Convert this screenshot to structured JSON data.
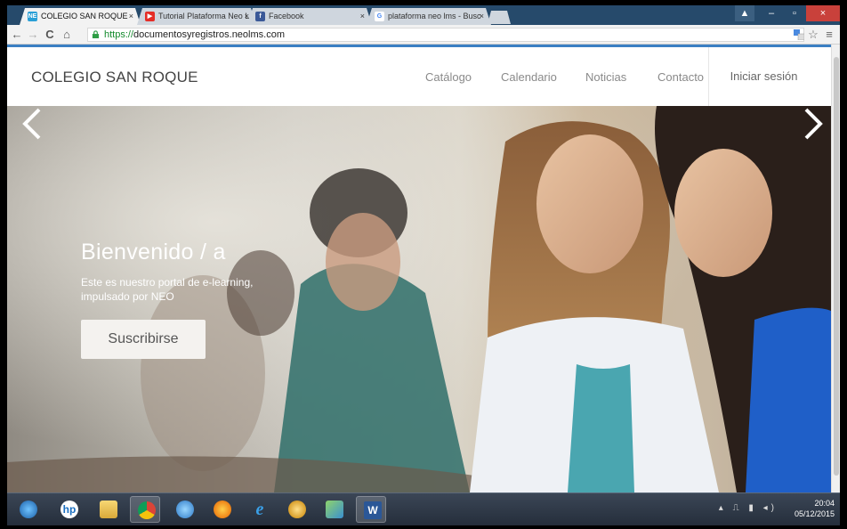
{
  "browser": {
    "tabs": [
      {
        "label": "COLEGIO SAN ROQUE",
        "favicon": "neo-favicon-icon",
        "favcolor": "#2a9fd6",
        "active": true
      },
      {
        "label": "Tutorial Plataforma Neo L",
        "favicon": "youtube-icon",
        "favcolor": "#e52d27",
        "active": false
      },
      {
        "label": "Facebook",
        "favicon": "facebook-icon",
        "favcolor": "#3b5998",
        "active": false
      },
      {
        "label": "plataforma neo lms - Busc",
        "favicon": "google-icon",
        "favcolor": "#4285f4",
        "active": false
      }
    ],
    "tab_close": "×",
    "url_scheme": "https://",
    "url_host": "documentosyregistros.neolms.com",
    "back": "←",
    "forward": "→",
    "reload": "C",
    "home": "⌂",
    "translate_icon": "translate-icon",
    "star": "☆",
    "menu": "≡",
    "win_min": "–",
    "win_max": "▫",
    "win_close": "×",
    "win_user": "▲"
  },
  "site": {
    "brand": "COLEGIO SAN ROQUE",
    "nav": [
      "Catálogo",
      "Calendario",
      "Noticias",
      "Contacto"
    ],
    "login": "Iniciar sesión",
    "accent": "#3a7fc3"
  },
  "hero": {
    "title": "Bienvenido / a",
    "subtitle": "Este es nuestro portal de e-learning, impulsado por NEO",
    "button": "Suscribirse",
    "prev_icon": "chevron-left-icon",
    "next_icon": "chevron-right-icon"
  },
  "taskbar": {
    "apps": [
      "windows-start-icon",
      "hp-icon",
      "file-explorer-icon",
      "chrome-icon",
      "windows-update-icon",
      "firefox-icon",
      "internet-explorer-icon",
      "media-player-icon",
      "games-icon",
      "word-icon"
    ],
    "tray_symbols": "▴ ⎍ ▮ ◂)",
    "time": "20:04",
    "date": "05/12/2015"
  }
}
